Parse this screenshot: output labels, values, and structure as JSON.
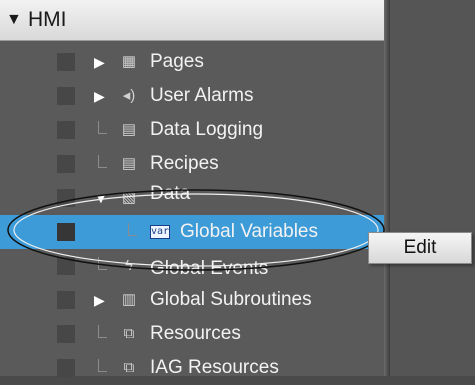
{
  "tree": {
    "root_label": "HMI",
    "items": [
      {
        "label": "Pages",
        "icon": "pages-icon",
        "expander": "collapsed"
      },
      {
        "label": "User Alarms",
        "icon": "speaker-icon",
        "expander": "collapsed"
      },
      {
        "label": "Data Logging",
        "icon": "data-logging-icon",
        "expander": "leaf"
      },
      {
        "label": "Recipes",
        "icon": "recipes-icon",
        "expander": "leaf"
      },
      {
        "label": "Data",
        "icon": "data-folder-icon",
        "expander": "expanded"
      },
      {
        "label": "Global Variables",
        "icon": "var-icon",
        "expander": "leaf",
        "selected": true
      },
      {
        "label": "Global Events",
        "icon": "lightning-icon",
        "expander": "leaf"
      },
      {
        "label": "Global Subroutines",
        "icon": "subroutine-icon",
        "expander": "collapsed"
      },
      {
        "label": "Resources",
        "icon": "resources-icon",
        "expander": "leaf"
      },
      {
        "label": "IAG Resources",
        "icon": "iag-resources-icon",
        "expander": "leaf"
      }
    ],
    "var_icon_text": "var"
  },
  "context_menu": {
    "edit_label": "Edit"
  },
  "colors": {
    "selection": "#3d9bd8",
    "panel_bg": "#5a5a5a"
  }
}
